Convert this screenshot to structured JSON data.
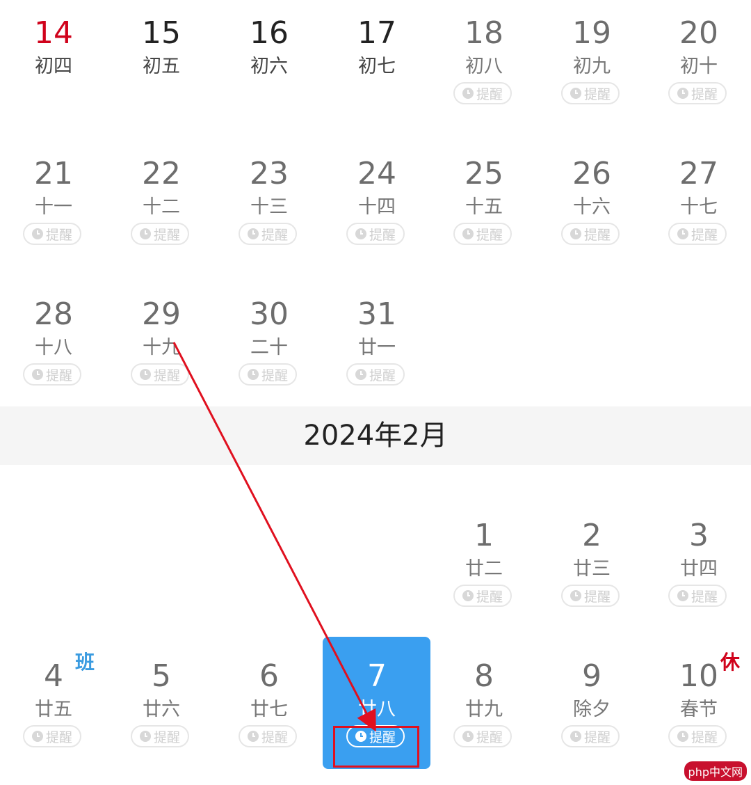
{
  "month_title": "2024年2月",
  "remind_label": "提醒",
  "january": [
    {
      "day": "14",
      "lunar": "初四",
      "style": "red",
      "remind": false
    },
    {
      "day": "15",
      "lunar": "初五",
      "style": "black",
      "remind": false
    },
    {
      "day": "16",
      "lunar": "初六",
      "style": "black",
      "remind": false
    },
    {
      "day": "17",
      "lunar": "初七",
      "style": "black",
      "remind": false
    },
    {
      "day": "18",
      "lunar": "初八",
      "style": "dim",
      "remind": true
    },
    {
      "day": "19",
      "lunar": "初九",
      "style": "dim",
      "remind": true
    },
    {
      "day": "20",
      "lunar": "初十",
      "style": "dim",
      "remind": true
    },
    {
      "day": "21",
      "lunar": "十一",
      "style": "dim",
      "remind": true
    },
    {
      "day": "22",
      "lunar": "十二",
      "style": "dim",
      "remind": true
    },
    {
      "day": "23",
      "lunar": "十三",
      "style": "dim",
      "remind": true
    },
    {
      "day": "24",
      "lunar": "十四",
      "style": "dim",
      "remind": true
    },
    {
      "day": "25",
      "lunar": "十五",
      "style": "dim",
      "remind": true
    },
    {
      "day": "26",
      "lunar": "十六",
      "style": "dim",
      "remind": true
    },
    {
      "day": "27",
      "lunar": "十七",
      "style": "dim",
      "remind": true
    },
    {
      "day": "28",
      "lunar": "十八",
      "style": "dim",
      "remind": true
    },
    {
      "day": "29",
      "lunar": "十九",
      "style": "dim",
      "remind": true
    },
    {
      "day": "30",
      "lunar": "二十",
      "style": "dim",
      "remind": true
    },
    {
      "day": "31",
      "lunar": "廿一",
      "style": "dim",
      "remind": true
    }
  ],
  "february": [
    {
      "day": "1",
      "lunar": "廿二",
      "style": "dim",
      "remind": true
    },
    {
      "day": "2",
      "lunar": "廿三",
      "style": "dim",
      "remind": true
    },
    {
      "day": "3",
      "lunar": "廿四",
      "style": "dim",
      "remind": true
    },
    {
      "day": "4",
      "lunar": "廿五",
      "style": "dim",
      "remind": true,
      "badge": "班"
    },
    {
      "day": "5",
      "lunar": "廿六",
      "style": "dim",
      "remind": true
    },
    {
      "day": "6",
      "lunar": "廿七",
      "style": "dim",
      "remind": true
    },
    {
      "day": "7",
      "lunar": "廿八",
      "style": "selected",
      "remind": true
    },
    {
      "day": "8",
      "lunar": "廿九",
      "style": "dim",
      "remind": true
    },
    {
      "day": "9",
      "lunar": "除夕",
      "style": "dim",
      "remind": true
    },
    {
      "day": "10",
      "lunar": "春节",
      "style": "dim",
      "remind": true,
      "badge": "休"
    }
  ],
  "colors": {
    "selected_bg": "#3a9ff0",
    "holiday_red": "#d0021b",
    "workday_blue": "#3a9be0",
    "annotation_red": "#e0101f"
  },
  "watermark": "php中文网"
}
